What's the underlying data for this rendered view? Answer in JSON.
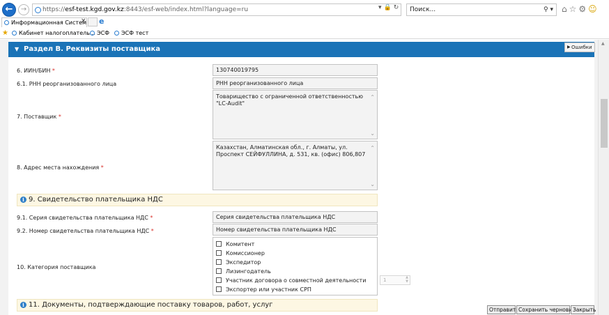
{
  "browser": {
    "url_prefix": "https://",
    "url_host": "esf-test.kgd.gov.kz",
    "url_rest": ":8443/esf-web/index.html?language=ru",
    "search_placeholder": "Поиск...",
    "tab_title": "Информационная Систем...",
    "favorites": [
      "Кабинет налогоплатель...",
      "ЭСФ",
      "ЭСФ тест"
    ]
  },
  "section": {
    "title": "Раздел B. Реквизиты поставщика",
    "errors_label": "Ошибки"
  },
  "fields": {
    "iin_label": "6. ИИН/БИН",
    "iin_value": "130740019795",
    "rnn_label": "6.1. РНН реорганизованного лица",
    "rnn_placeholder": "РНН реорганизованного лица",
    "supplier_label": "7. Поставщик",
    "supplier_value": "Товарищество с ограниченной ответственностью \"LC-Audit\"",
    "address_label": "8. Адрес места нахождения",
    "address_value": "Казахстан, Алматинская обл., г. Алматы, ул. Проспект СЕЙФУЛЛИНА, д. 531, кв. (офис) 806,807"
  },
  "vat_section": {
    "title": "9. Свидетельство плательщика НДС",
    "series_label": "9.1. Серия свидетельства плательщика НДС",
    "series_placeholder": "Серия свидетельства плательщика НДС",
    "number_label": "9.2. Номер свидетельства плательщика НДС",
    "number_placeholder": "Номер свидетельства плательщика НДС"
  },
  "category": {
    "label": "10. Категория поставщика",
    "options": [
      "Комитент",
      "Комиссионер",
      "Экспедитор",
      "Лизингодатель",
      "Участник договора о совместной деятельности",
      "Экспортер или участник СРП"
    ],
    "spinner_value": "1"
  },
  "docs_section": {
    "title": "11. Документы, подтверждающие поставку товаров, работ, услуг"
  },
  "footer": {
    "send": "Отправить",
    "save_draft": "Сохранить черновик",
    "close": "Закрыть"
  }
}
